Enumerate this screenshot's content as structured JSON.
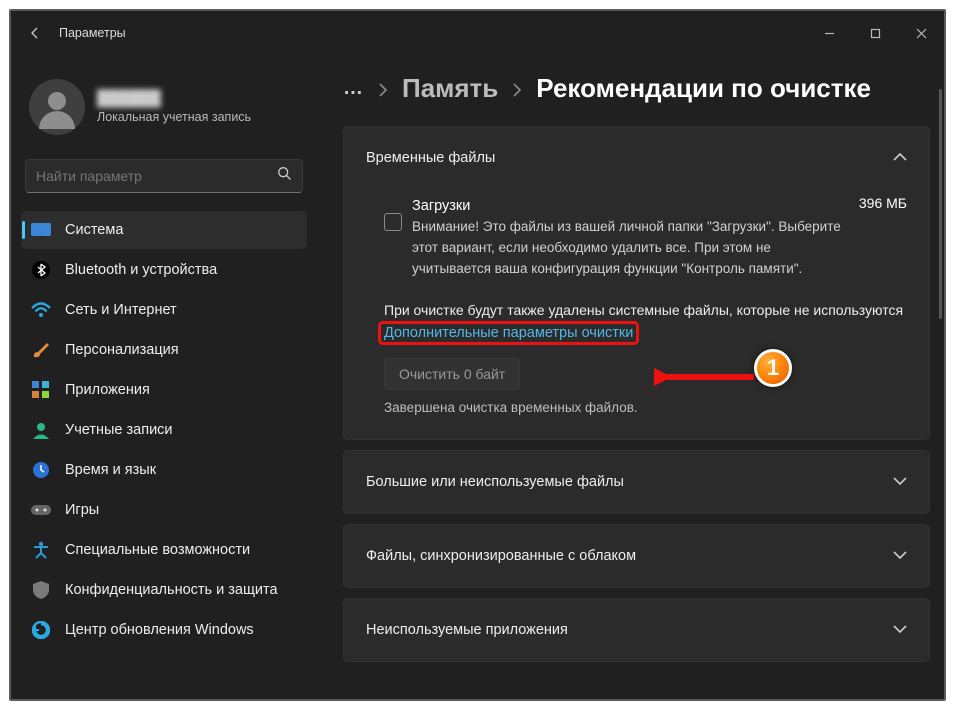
{
  "window": {
    "title": "Параметры"
  },
  "profile": {
    "name": "██████",
    "sub": "Локальная учетная запись"
  },
  "search": {
    "placeholder": "Найти параметр"
  },
  "nav": {
    "items": [
      {
        "label": "Система"
      },
      {
        "label": "Bluetooth и устройства"
      },
      {
        "label": "Сеть и Интернет"
      },
      {
        "label": "Персонализация"
      },
      {
        "label": "Приложения"
      },
      {
        "label": "Учетные записи"
      },
      {
        "label": "Время и язык"
      },
      {
        "label": "Игры"
      },
      {
        "label": "Специальные возможности"
      },
      {
        "label": "Конфиденциальность и защита"
      },
      {
        "label": "Центр обновления Windows"
      }
    ]
  },
  "breadcrumb": {
    "dots": "…",
    "storage": "Память",
    "current": "Рекомендации по очистке"
  },
  "panels": {
    "temp_title": "Временные файлы",
    "downloads": {
      "title": "Загрузки",
      "warning": "Внимание! Это файлы из вашей личной папки \"Загрузки\". Выберите этот вариант, если необходимо удалить все. При этом не учитывается ваша конфигурация функции \"Контроль памяти\".",
      "size": "396 МБ"
    },
    "note": "При очистке будут также удалены системные файлы, которые не используются",
    "link": "Дополнительные параметры очистки",
    "clean_btn": "Очистить 0 байт",
    "done": "Завершена очистка временных файлов.",
    "large_title": "Большие или неиспользуемые файлы",
    "cloud_title": "Файлы, синхронизированные с облаком",
    "apps_title": "Неиспользуемые приложения"
  },
  "annotation": {
    "num": "1"
  }
}
